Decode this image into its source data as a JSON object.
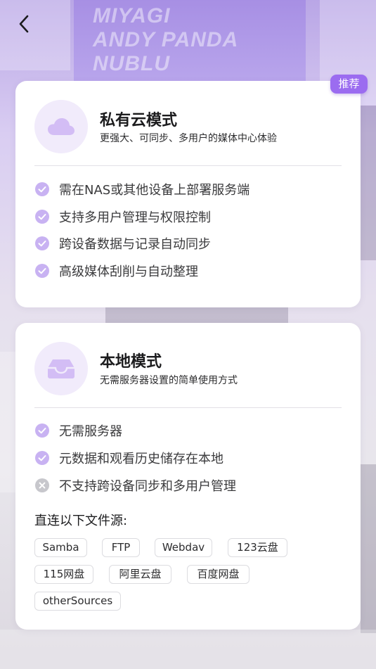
{
  "background": {
    "poster_lines": [
      "MIYAGI",
      "ANDY PANDA",
      "NUBLU"
    ]
  },
  "nav": {
    "back_icon": "chevron-left-icon"
  },
  "cloud_mode": {
    "badge": "推荐",
    "icon": "cloud-icon",
    "title": "私有云模式",
    "subtitle": "更强大、可同步、多用户的媒体中心体验",
    "features": [
      {
        "text": "需在NAS或其他设备上部署服务端",
        "status": "check"
      },
      {
        "text": "支持多用户管理与权限控制",
        "status": "check"
      },
      {
        "text": "跨设备数据与记录自动同步",
        "status": "check"
      },
      {
        "text": "高级媒体刮削与自动整理",
        "status": "check"
      }
    ]
  },
  "local_mode": {
    "icon": "inbox-icon",
    "title": "本地模式",
    "subtitle": "无需服务器设置的简单使用方式",
    "features": [
      {
        "text": "无需服务器",
        "status": "check"
      },
      {
        "text": "元数据和观看历史储存在本地",
        "status": "check"
      },
      {
        "text": "不支持跨设备同步和多用户管理",
        "status": "cross"
      }
    ],
    "sources_title": "直连以下文件源:",
    "sources": [
      "Samba",
      "FTP",
      "Webdav",
      "123云盘",
      "115网盘",
      "阿里云盘",
      "百度网盘",
      "otherSources"
    ]
  },
  "colors": {
    "accent": "#9b6cf0",
    "check_fill": "#c8b2f2",
    "cross_fill": "#c7c7cc",
    "icon_bg": "#f1ebfb",
    "icon_fg": "#d3bdf5"
  }
}
